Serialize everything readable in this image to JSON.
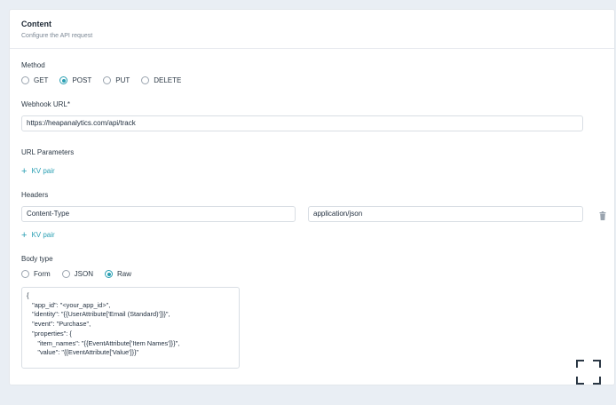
{
  "header": {
    "title": "Content",
    "subtitle": "Configure the API request"
  },
  "method": {
    "label": "Method",
    "options": [
      "GET",
      "POST",
      "PUT",
      "DELETE"
    ],
    "selected": "POST"
  },
  "webhook": {
    "label": "Webhook URL*",
    "value": "https://heapanalytics.com/api/track"
  },
  "url_params": {
    "label": "URL Parameters",
    "add_label": "KV pair"
  },
  "headers": {
    "label": "Headers",
    "rows": [
      {
        "key": "Content-Type",
        "value": "application/json"
      }
    ],
    "add_label": "KV pair"
  },
  "body_type": {
    "label": "Body type",
    "options": [
      "Form",
      "JSON",
      "Raw"
    ],
    "selected": "Raw",
    "raw_lines": [
      "{",
      "   \"app_id\": \"<your_app_id>\",",
      "   \"identity\": \"{{UserAttribute['Email (Standard)']}}\",",
      "   \"event\": \"Purchase\",",
      "   \"properties\": {",
      "      \"item_names\": \"{{EventAttribute['Item Names']}}\",",
      "      \"value\": \"{{EventAttribute['Value']}}\""
    ]
  },
  "icons": {
    "add": "plus-icon",
    "delete": "trash-icon",
    "expand": "expand-icon"
  },
  "colors": {
    "accent": "#2a9fb3",
    "background": "#e9eef4"
  }
}
